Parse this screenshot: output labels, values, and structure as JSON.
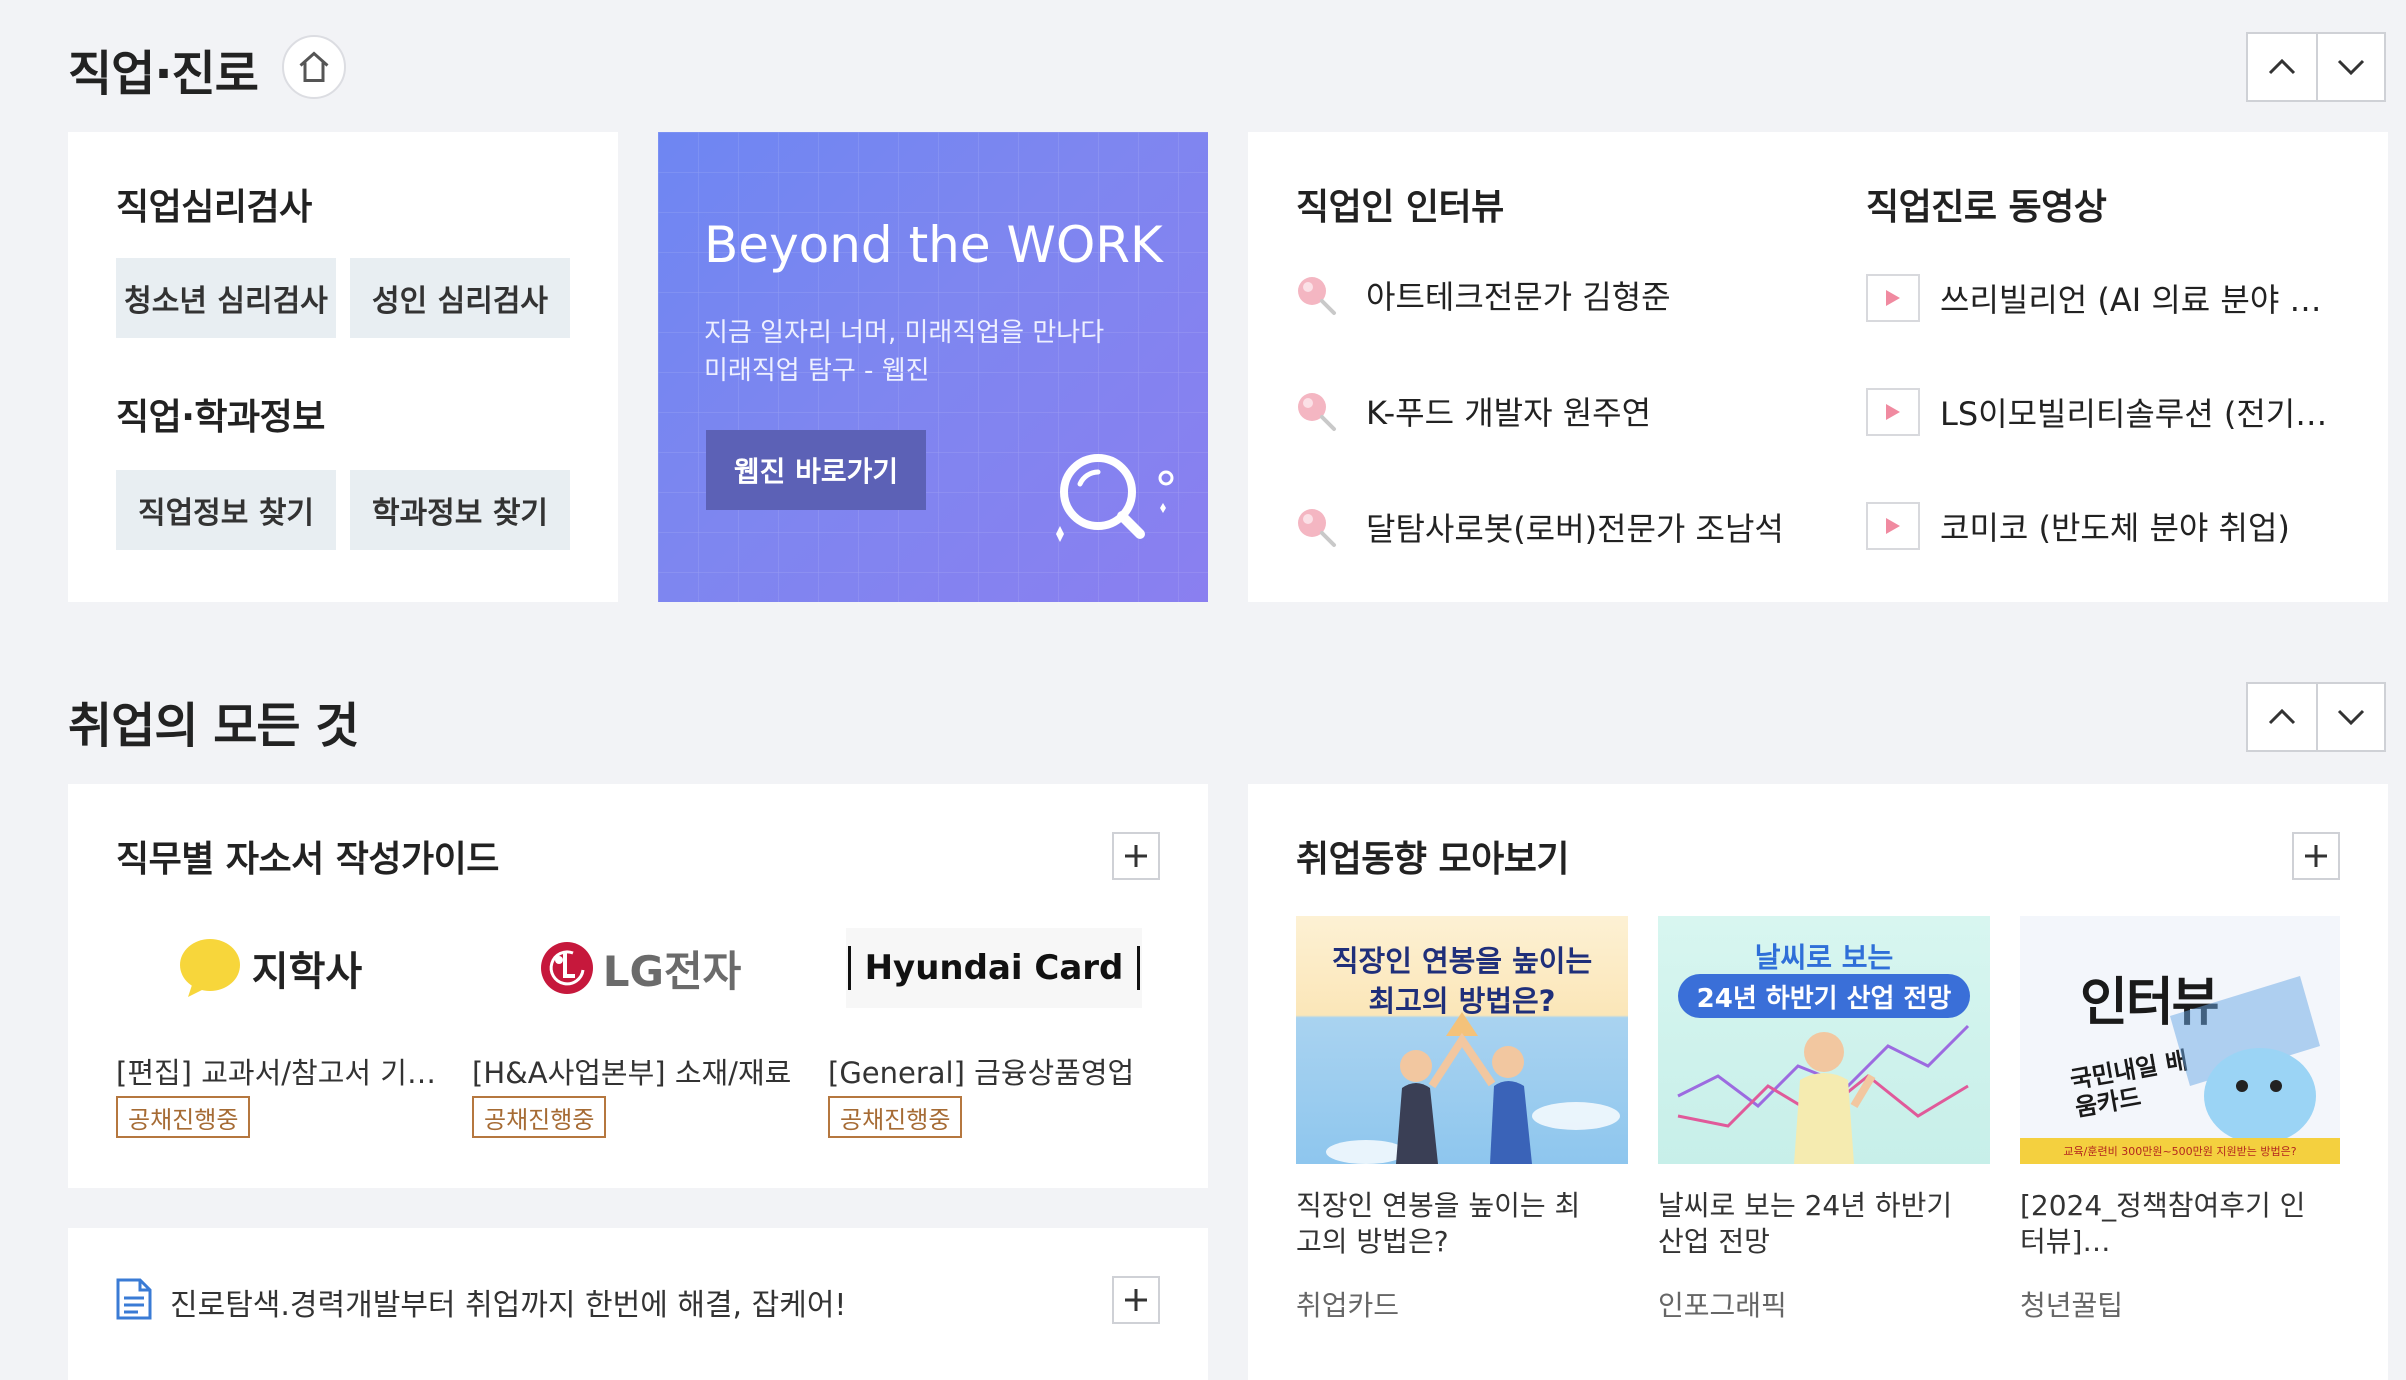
{
  "section1": {
    "title": "직업·진로"
  },
  "psych": {
    "title": "직업심리검사",
    "btn1": "청소년 심리검사",
    "btn2": "성인 심리검사"
  },
  "jobinfo": {
    "title": "직업·학과정보",
    "btn1": "직업정보 찾기",
    "btn2": "학과정보 찾기"
  },
  "banner": {
    "title": "Beyond the WORK",
    "sub1": "지금 일자리 너머, 미래직업을 만나다",
    "sub2": "미래직업 탐구 - 웹진",
    "button": "웹진 바로가기"
  },
  "interview": {
    "title": "직업인 인터뷰",
    "items": [
      "아트테크전문가 김형준",
      "K-푸드 개발자 원주연",
      "달탐사로봇(로버)전문가 조남석"
    ]
  },
  "video": {
    "title": "직업진로 동영상",
    "items": [
      "쓰리빌리언 (AI 의료 분야 …",
      "LS이모빌리티솔루션 (전기…",
      "코미코 (반도체 분야 취업)"
    ]
  },
  "section2": {
    "title": "취업의 모든 것"
  },
  "guide": {
    "title": "직무별 자소서 작성가이드",
    "companies": [
      {
        "logo_text": "지학사",
        "job": "[편집] 교과서/참고서 기…",
        "badge": "공채진행중"
      },
      {
        "logo_text": "LG전자",
        "job": "[H&A사업본부] 소재/재료",
        "badge": "공채진행중"
      },
      {
        "logo_text": "Hyundai Card",
        "job": "[General] 금융상품영업",
        "badge": "공채진행중"
      }
    ]
  },
  "trends": {
    "title": "취업동향 모아보기",
    "items": [
      {
        "thumb_line1": "직장인 연봉을 높이는",
        "thumb_line2": "최고의 방법은?",
        "caption": "직장인 연봉을 높이는 최고의 방법은?",
        "category": "취업카드"
      },
      {
        "thumb_line1": "날씨로 보는",
        "thumb_line2": "24년 하반기 산업 전망",
        "caption": "날씨로 보는 24년 하반기 산업 전망",
        "category": "인포그래픽"
      },
      {
        "thumb_line1": "인터뷰",
        "thumb_line2": "국민내일 배움카드",
        "thumb_line3": "교육/훈련비 300만원~500만원 지원받는 방법은?",
        "caption": "[2024_정책참여후기 인터뷰]…",
        "category": "청년꿀팁"
      }
    ]
  },
  "notice": {
    "text": "진로탐색.경력개발부터 취업까지 한번에 해결, 잡케어!"
  },
  "colors": {
    "accent_brown": "#b5773f",
    "banner_start": "#6e86f2",
    "banner_end": "#8a7ff0",
    "lg_red": "#c6183c",
    "jihak_yellow": "#f7d63b"
  }
}
